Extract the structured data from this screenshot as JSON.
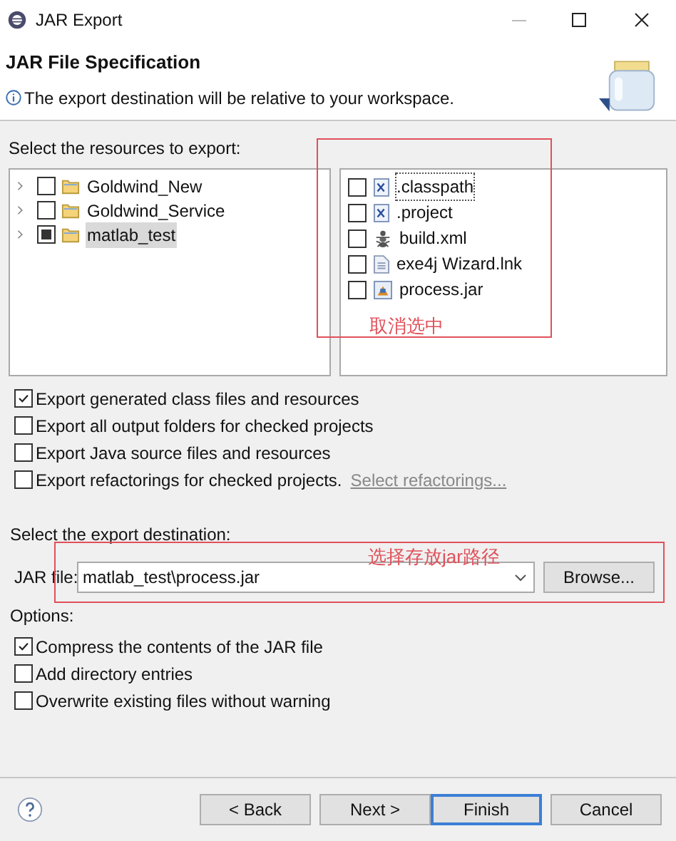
{
  "window": {
    "title": "JAR Export"
  },
  "header": {
    "title": "JAR File Specification",
    "message": "The export destination will be relative to your workspace."
  },
  "resources_label": "Select the resources to export:",
  "projects": [
    {
      "label": "Goldwind_New",
      "checked": false,
      "partial": false,
      "selected": false,
      "expanded": false
    },
    {
      "label": "Goldwind_Service",
      "checked": false,
      "partial": false,
      "selected": false,
      "expanded": false
    },
    {
      "label": "matlab_test",
      "checked": false,
      "partial": true,
      "selected": true,
      "expanded": false
    }
  ],
  "files": [
    {
      "label": ".classpath",
      "kind": "xml",
      "checked": false,
      "focused": true
    },
    {
      "label": ".project",
      "kind": "xml",
      "checked": false,
      "focused": false
    },
    {
      "label": "build.xml",
      "kind": "ant",
      "checked": false,
      "focused": false
    },
    {
      "label": "exe4j Wizard.lnk",
      "kind": "doc",
      "checked": false,
      "focused": false
    },
    {
      "label": "process.jar",
      "kind": "jar",
      "checked": false,
      "focused": false
    }
  ],
  "export_options": [
    {
      "label": "Export generated class files and resources",
      "checked": true
    },
    {
      "label": "Export all output folders for checked projects",
      "checked": false
    },
    {
      "label": "Export Java source files and resources",
      "checked": false
    },
    {
      "label": "Export refactorings for checked projects.",
      "checked": false,
      "link": "Select refactorings..."
    }
  ],
  "destination": {
    "label": "Select the export destination:",
    "field_label": "JAR file:",
    "value": "matlab_test\\process.jar",
    "browse": "Browse..."
  },
  "options_label": "Options:",
  "options": [
    {
      "label": "Compress the contents of the JAR file",
      "checked": true
    },
    {
      "label": "Add directory entries",
      "checked": false
    },
    {
      "label": "Overwrite existing files without warning",
      "checked": false
    }
  ],
  "buttons": [
    {
      "label": "< Back",
      "default": false
    },
    {
      "label": "Next >",
      "default": false
    },
    {
      "label": "Finish",
      "default": true
    },
    {
      "label": "Cancel",
      "default": false
    }
  ],
  "annotations": [
    "取消选中",
    "选择存放jar路径"
  ]
}
